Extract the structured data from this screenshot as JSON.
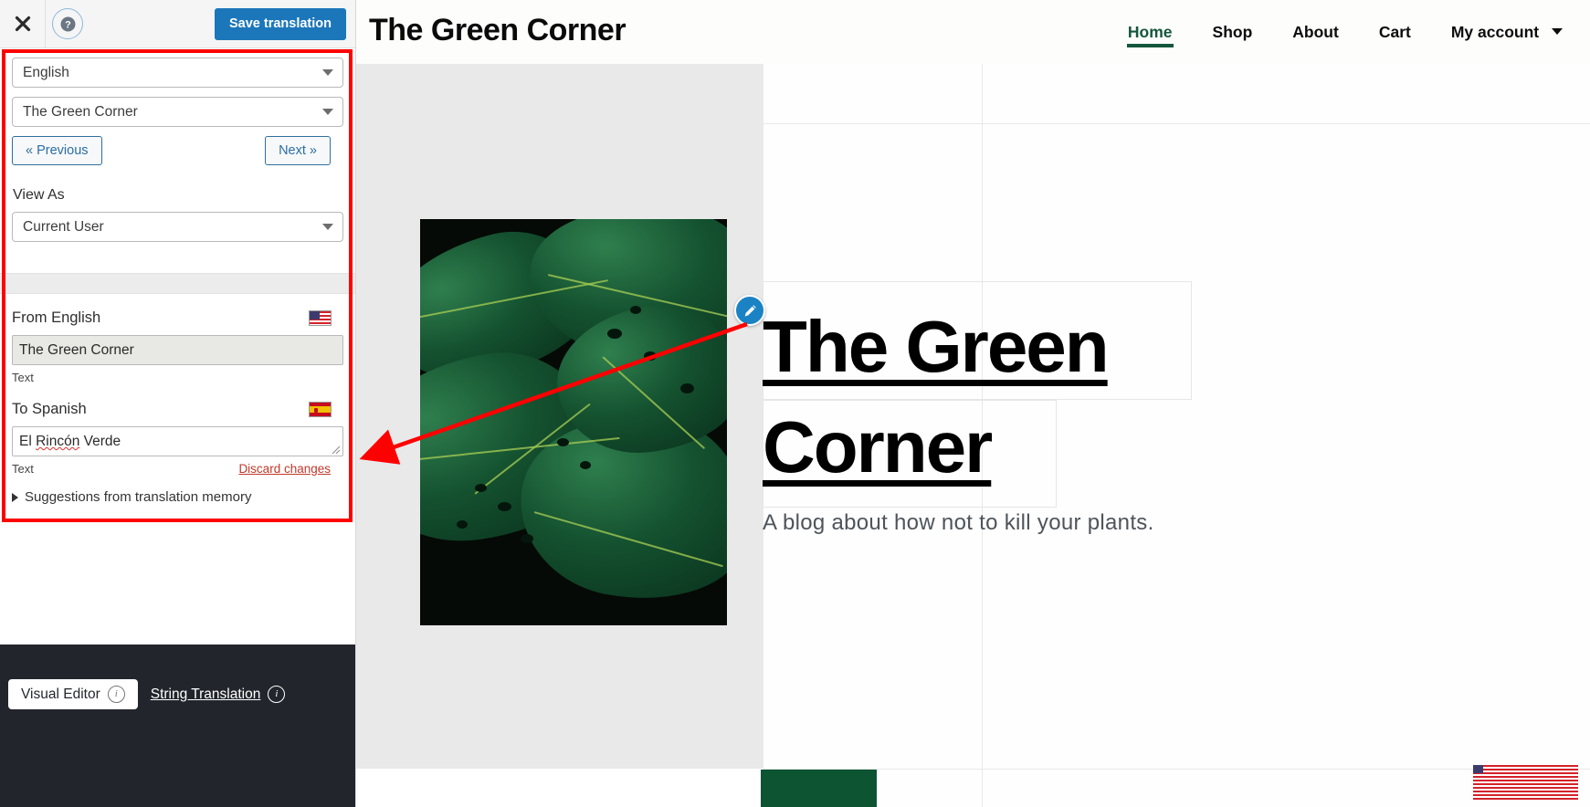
{
  "panel": {
    "toolbar": {
      "close_icon": "close-icon",
      "help_icon": "help-icon",
      "save_label": "Save translation"
    },
    "language_select": {
      "value": "English",
      "caret_icon": "chevron-down-icon"
    },
    "string_select": {
      "value": "The Green Corner",
      "caret_icon": "chevron-down-icon"
    },
    "prev_label": "« Previous",
    "next_label": "Next »",
    "view_as_label": "View As",
    "view_as_select": {
      "value": "Current User",
      "caret_icon": "chevron-down-icon"
    },
    "source": {
      "heading": "From English",
      "flag_icon": "flag-us-icon",
      "value": "The Green Corner",
      "type_label": "Text"
    },
    "target": {
      "heading": "To Spanish",
      "flag_icon": "flag-es-icon",
      "value_prefix": "El ",
      "value_misspelled": "Rincón",
      "value_suffix": " Verde",
      "value_full": "El Rincón Verde",
      "type_label": "Text",
      "discard_label": "Discard changes"
    },
    "suggestions_label": "Suggestions from translation memory",
    "footer": {
      "visual_editor_label": "Visual Editor",
      "string_translation_label": "String Translation",
      "info_icon": "info-icon"
    }
  },
  "preview": {
    "site_title": "The Green Corner",
    "nav": [
      {
        "label": "Home",
        "active": true
      },
      {
        "label": "Shop",
        "active": false
      },
      {
        "label": "About",
        "active": false
      },
      {
        "label": "Cart",
        "active": false
      },
      {
        "label": "My account",
        "active": false,
        "caret_icon": "chevron-down-icon"
      }
    ],
    "hero_title": "The Green Corner",
    "hero_subtitle": "A blog about how not to kill your plants.",
    "edit_icon": "pencil-edit-icon",
    "language_switcher": {
      "label": "English",
      "flag_icon": "flag-us-icon"
    }
  },
  "colors": {
    "accent_blue": "#1c77ba",
    "brand_green": "#14573c",
    "annotation_red": "#ff0000",
    "footer_dark": "#22262c"
  }
}
